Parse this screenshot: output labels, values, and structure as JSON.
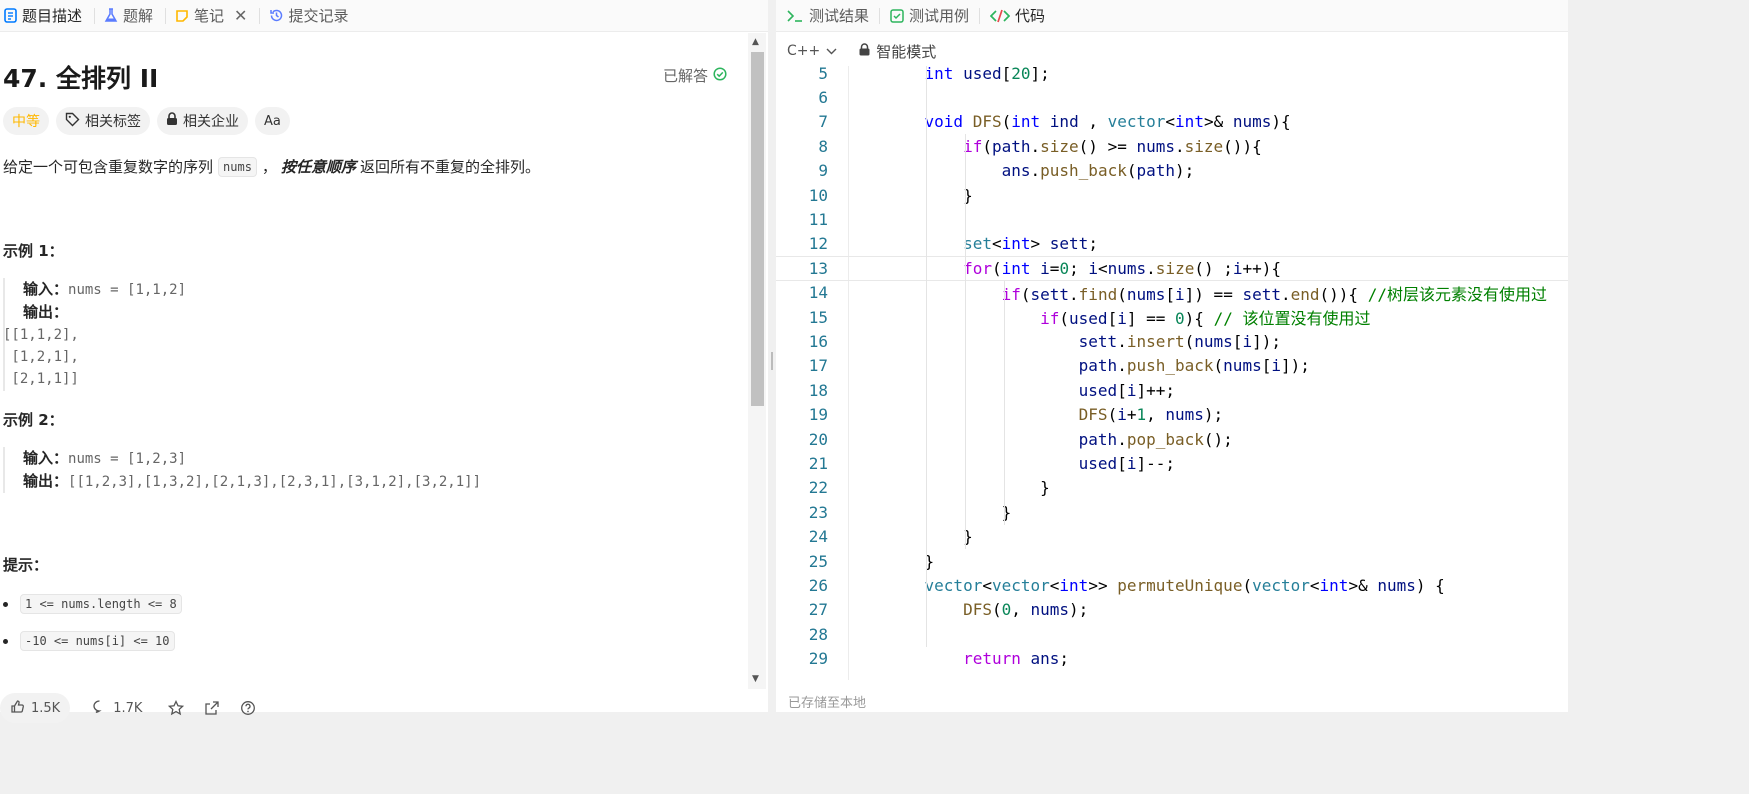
{
  "left_tabs": [
    {
      "label": "题目描述",
      "icon": "document-icon",
      "color": "#007aff"
    },
    {
      "label": "题解",
      "icon": "flask-icon",
      "color": "#5b7cff"
    },
    {
      "label": "笔记",
      "icon": "note-icon",
      "color": "#ffb800"
    },
    {
      "label": "提交记录",
      "icon": "history-icon",
      "color": "#5b7cff"
    }
  ],
  "problem": {
    "title": "47. 全排列 II",
    "status": "已解答",
    "difficulty": "中等",
    "tags": [
      "相关标签",
      "相关企业",
      "Aa"
    ],
    "desc_before": "给定一个可包含重复数字的序列",
    "desc_code": "nums",
    "desc_mid": "，",
    "desc_bold": "按任意顺序",
    "desc_after": "返回所有不重复的全排列。",
    "example1_title": "示例 1：",
    "example1_input_label": "输入：",
    "example1_input": "nums = [1,1,2]",
    "example1_output_label": "输出：",
    "example1_output_lines": [
      "[[1,1,2],",
      " [1,2,1],",
      " [2,1,1]]"
    ],
    "example2_title": "示例 2：",
    "example2_input_label": "输入：",
    "example2_input": "nums = [1,2,3]",
    "example2_output_label": "输出：",
    "example2_output": "[[1,2,3],[1,3,2],[2,1,3],[2,3,1],[3,1,2],[3,2,1]]",
    "hints_title": "提示：",
    "hints": [
      "1 <= nums.length <= 8",
      "-10 <= nums[i] <= 10"
    ]
  },
  "bottom": {
    "likes": "1.5K",
    "comments": "1.7K"
  },
  "right_tabs": [
    {
      "label": "测试结果",
      "icon": "terminal-icon",
      "color": "#2db55d"
    },
    {
      "label": "测试用例",
      "icon": "checkbox-icon",
      "color": "#2db55d"
    },
    {
      "label": "代码",
      "icon": "code-icon",
      "color": "#2db55d"
    }
  ],
  "editor_toolbar": {
    "language": "C++",
    "mode": "智能模式"
  },
  "status_text": "已存储至本地",
  "code": {
    "current_line": 13,
    "lines": [
      {
        "n": "5",
        "text": "    int used[20];"
      },
      {
        "n": "6",
        "text": ""
      },
      {
        "n": "7",
        "text": "    void DFS(int ind , vector<int>& nums){"
      },
      {
        "n": "8",
        "text": "        if(path.size() >= nums.size()){"
      },
      {
        "n": "9",
        "text": "            ans.push_back(path);"
      },
      {
        "n": "10",
        "text": "        }"
      },
      {
        "n": "11",
        "text": ""
      },
      {
        "n": "12",
        "text": "        set<int> sett;"
      },
      {
        "n": "13",
        "text": "        for(int i=0; i<nums.size() ;i++){"
      },
      {
        "n": "14",
        "text": "            if(sett.find(nums[i]) == sett.end()){ //树层该元素没有使用过"
      },
      {
        "n": "15",
        "text": "                if(used[i] == 0){ // 该位置没有使用过"
      },
      {
        "n": "16",
        "text": "                    sett.insert(nums[i]);"
      },
      {
        "n": "17",
        "text": "                    path.push_back(nums[i]);"
      },
      {
        "n": "18",
        "text": "                    used[i]++;"
      },
      {
        "n": "19",
        "text": "                    DFS(i+1, nums);"
      },
      {
        "n": "20",
        "text": "                    path.pop_back();"
      },
      {
        "n": "21",
        "text": "                    used[i]--;"
      },
      {
        "n": "22",
        "text": "                }"
      },
      {
        "n": "23",
        "text": "            }"
      },
      {
        "n": "24",
        "text": "        }"
      },
      {
        "n": "25",
        "text": "    }"
      },
      {
        "n": "26",
        "text": "    vector<vector<int>> permuteUnique(vector<int>& nums) {"
      },
      {
        "n": "27",
        "text": "        DFS(0, nums);"
      },
      {
        "n": "28",
        "text": ""
      },
      {
        "n": "29",
        "text": "        return ans;"
      }
    ]
  },
  "colors": {
    "keyword": "#0000ff",
    "control": "#af00db",
    "type": "#267f99",
    "function": "#795e26",
    "variable": "#001080",
    "number": "#098658",
    "comment": "#008000",
    "line_number": "#237893",
    "difficulty_medium": "#ffb800",
    "solved_check": "#2db55d"
  }
}
